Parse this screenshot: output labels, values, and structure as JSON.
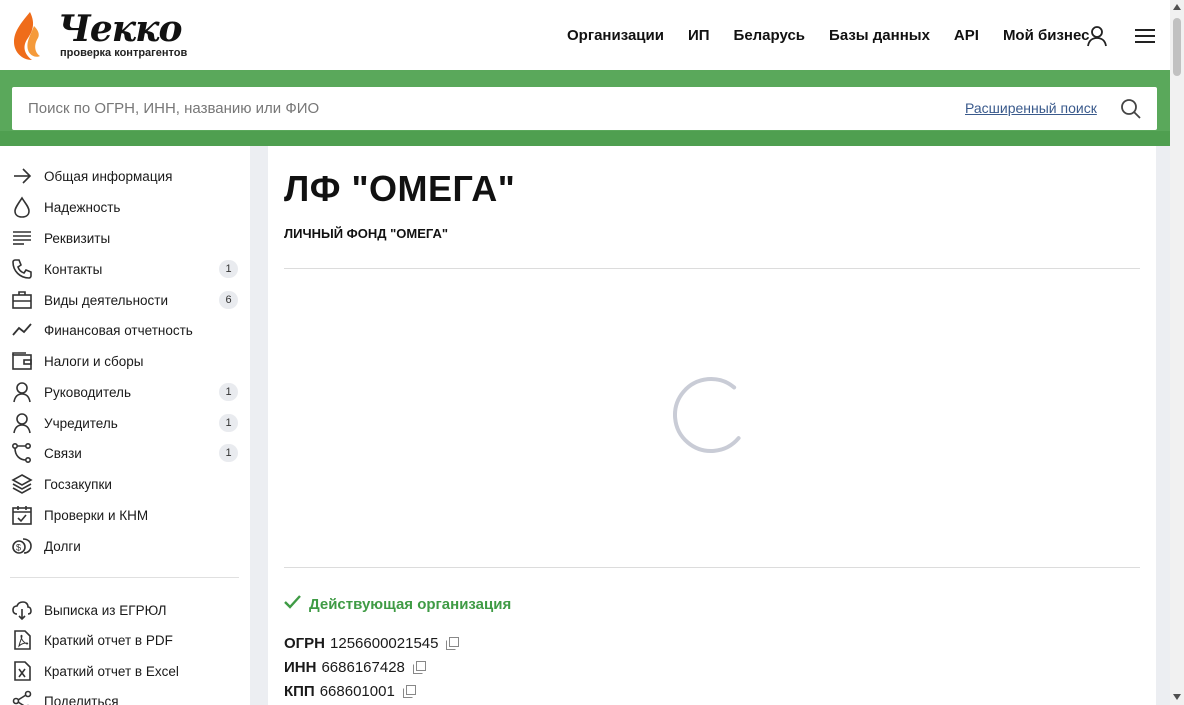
{
  "brand": {
    "name": "Чекко",
    "tagline": "проверка контрагентов",
    "accent": "#5aa85b"
  },
  "nav": [
    {
      "label": "Организации"
    },
    {
      "label": "ИП"
    },
    {
      "label": "Беларусь"
    },
    {
      "label": "Базы данных"
    },
    {
      "label": "API"
    },
    {
      "label": "Мой бизнес"
    }
  ],
  "search": {
    "placeholder": "Поиск по ОГРН, ИНН, названию или ФИО",
    "advanced_label": "Расширенный поиск"
  },
  "sidebar": {
    "items": [
      {
        "label": "Общая информация",
        "icon": "arrow-right-icon"
      },
      {
        "label": "Надежность",
        "icon": "drop-icon"
      },
      {
        "label": "Реквизиты",
        "icon": "lines-icon"
      },
      {
        "label": "Контакты",
        "icon": "phone-icon",
        "badge": "1"
      },
      {
        "label": "Виды деятельности",
        "icon": "briefcase-icon",
        "badge": "6"
      },
      {
        "label": "Финансовая отчетность",
        "icon": "chart-line-icon"
      },
      {
        "label": "Налоги и сборы",
        "icon": "wallet-icon"
      },
      {
        "label": "Руководитель",
        "icon": "person-icon",
        "badge": "1"
      },
      {
        "label": "Учредитель",
        "icon": "person-icon",
        "badge": "1"
      },
      {
        "label": "Связи",
        "icon": "connections-icon",
        "badge": "1"
      },
      {
        "label": "Госзакупки",
        "icon": "layers-icon"
      },
      {
        "label": "Проверки и КНМ",
        "icon": "calendar-check-icon"
      },
      {
        "label": "Долги",
        "icon": "coins-icon"
      }
    ],
    "actions": [
      {
        "label": "Выписка из ЕГРЮЛ",
        "icon": "cloud-download-icon"
      },
      {
        "label": "Краткий отчет в PDF",
        "icon": "pdf-icon"
      },
      {
        "label": "Краткий отчет в Excel",
        "icon": "excel-icon"
      },
      {
        "label": "Поделиться",
        "icon": "share-icon"
      }
    ]
  },
  "company": {
    "short_name": "ЛФ \"ОМЕГА\"",
    "full_name": "ЛИЧНЫЙ ФОНД \"ОМЕГА\"",
    "status": "Действующая организация",
    "status_color": "#3f9b45",
    "requisites": [
      {
        "key": "ОГРН",
        "value": "1256600021545"
      },
      {
        "key": "ИНН",
        "value": "6686167428"
      },
      {
        "key": "КПП",
        "value": "668601001"
      }
    ]
  }
}
